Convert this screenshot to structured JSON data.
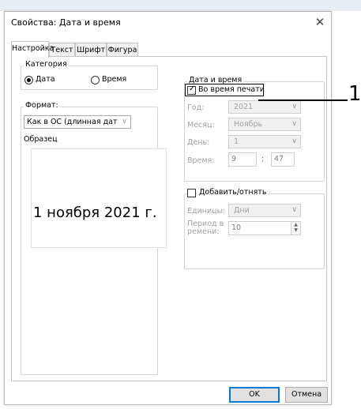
{
  "window": {
    "title": "Свойства: Дата и время",
    "close_glyph": "✕"
  },
  "tabs": [
    "Настройка",
    "Текст",
    "Шрифт",
    "Фигура"
  ],
  "category": {
    "legend": "Категория",
    "date_label": "Дата",
    "time_label": "Время",
    "selected": "Дата"
  },
  "format": {
    "legend": "Формат:",
    "value": "Как в ОС (длинная дат",
    "sample_legend": "Образец",
    "sample_text": "1 ноября 2021 г."
  },
  "datetime": {
    "legend": "Дата и время",
    "print_time_label": "Во время печати",
    "print_time_checked": true,
    "year_label": "Год:",
    "year_value": "2021",
    "month_label": "Месяц:",
    "month_value": "Ноябрь",
    "day_label": "День:",
    "day_value": "1",
    "time_label": "Время:",
    "hour_value": "9",
    "time_sep": ":",
    "minute_value": "47"
  },
  "addsub": {
    "checkbox_label": "Добавить/отнять",
    "checked": false,
    "units_label": "Единицы:",
    "units_value": "Дни",
    "period_label_1": "Период в",
    "period_label_2": "ремени:",
    "period_value": "10"
  },
  "buttons": {
    "ok": "OK",
    "cancel": "Отмена"
  },
  "callout": {
    "number": "1"
  },
  "colors": {
    "accent": "#0078d7",
    "disabled_text": "#a0a0a0"
  }
}
